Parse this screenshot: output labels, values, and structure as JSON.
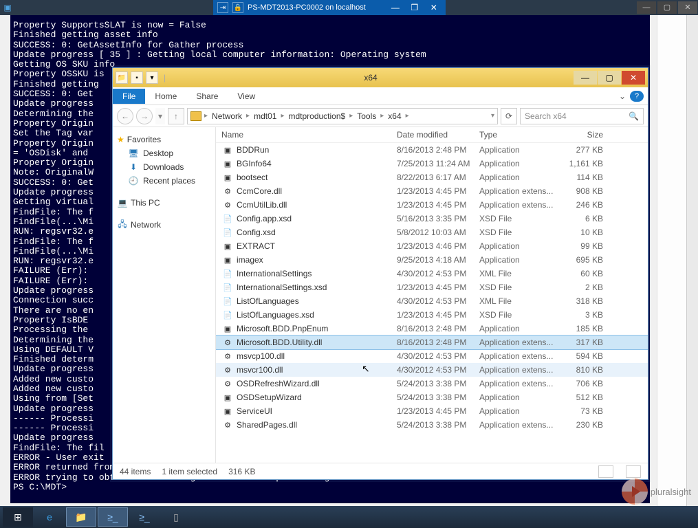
{
  "outer_window": {
    "title": ""
  },
  "vm_bar": {
    "title": "PS-MDT2013-PC0002 on localhost"
  },
  "console_lines": [
    "Property SupportsSLAT is now = False",
    "Finished getting asset info",
    "SUCCESS: 0: GetAssetInfo for Gather process",
    "Update progress [ 35 ] : Getting local computer information: Operating system",
    "Getting OS SKU info",
    "Property OSSKU is",
    "Finished getting",
    "SUCCESS: 0: Get",
    "Update progress",
    "Determining the",
    "Property Origin",
    "Set the Tag var",
    "Property Origin",
    "= 'OSDisk' and",
    "Property Origin",
    "Note: OriginalW",
    "SUCCESS: 0: Get",
    "Update progress",
    "Getting virtual",
    "FindFile: The f",
    "FindFile(...\\Mi",
    "RUN: regsvr32.e",
    "FindFile: The f",
    "FindFile(...\\Mi",
    "RUN: regsvr32.e",
    "FAILURE (Err):",
    "FAILURE (Err):",
    "Update progress",
    "Connection succ",
    "There are no en",
    "Property IsBDE",
    "Processing the",
    "Determining the",
    "Using DEFAULT V",
    "Finished determ",
    "Update progress",
    "Added new custo",
    "Added new custo",
    "Using from [Set",
    "Update progress",
    "------ Processi",
    "------ Processi",
    "Update progress",
    "FindFile: The fil",
    "ERROR - User exit",
    "ERROR returned from",
    "ERROR trying to obtain ini settings.  No further processing.",
    "PS C:\\MDT>"
  ],
  "explorer": {
    "title": "x64",
    "tabs": {
      "file": "File",
      "home": "Home",
      "share": "Share",
      "view": "View"
    },
    "breadcrumb": [
      "Network",
      "mdt01",
      "mdtproduction$",
      "Tools",
      "x64"
    ],
    "search_placeholder": "Search x64",
    "columns": {
      "name": "Name",
      "date": "Date modified",
      "type": "Type",
      "size": "Size"
    },
    "nav": {
      "favorites": "Favorites",
      "desktop": "Desktop",
      "downloads": "Downloads",
      "recent": "Recent places",
      "thispc": "This PC",
      "network": "Network"
    },
    "files": [
      {
        "name": "BDDRun",
        "date": "8/16/2013 2:48 PM",
        "type": "Application",
        "size": "277 KB"
      },
      {
        "name": "BGInfo64",
        "date": "7/25/2013 11:24 AM",
        "type": "Application",
        "size": "1,161 KB"
      },
      {
        "name": "bootsect",
        "date": "8/22/2013 6:17 AM",
        "type": "Application",
        "size": "114 KB"
      },
      {
        "name": "CcmCore.dll",
        "date": "1/23/2013 4:45 PM",
        "type": "Application extens...",
        "size": "908 KB"
      },
      {
        "name": "CcmUtilLib.dll",
        "date": "1/23/2013 4:45 PM",
        "type": "Application extens...",
        "size": "246 KB"
      },
      {
        "name": "Config.app.xsd",
        "date": "5/16/2013 3:35 PM",
        "type": "XSD File",
        "size": "6 KB"
      },
      {
        "name": "Config.xsd",
        "date": "5/8/2012 10:03 AM",
        "type": "XSD File",
        "size": "10 KB"
      },
      {
        "name": "EXTRACT",
        "date": "1/23/2013 4:46 PM",
        "type": "Application",
        "size": "99 KB"
      },
      {
        "name": "imagex",
        "date": "9/25/2013 4:18 AM",
        "type": "Application",
        "size": "695 KB"
      },
      {
        "name": "InternationalSettings",
        "date": "4/30/2012 4:53 PM",
        "type": "XML File",
        "size": "60 KB"
      },
      {
        "name": "InternationalSettings.xsd",
        "date": "1/23/2013 4:45 PM",
        "type": "XSD File",
        "size": "2 KB"
      },
      {
        "name": "ListOfLanguages",
        "date": "4/30/2012 4:53 PM",
        "type": "XML File",
        "size": "318 KB"
      },
      {
        "name": "ListOfLanguages.xsd",
        "date": "1/23/2013 4:45 PM",
        "type": "XSD File",
        "size": "3 KB"
      },
      {
        "name": "Microsoft.BDD.PnpEnum",
        "date": "8/16/2013 2:48 PM",
        "type": "Application",
        "size": "185 KB"
      },
      {
        "name": "Microsoft.BDD.Utility.dll",
        "date": "8/16/2013 2:48 PM",
        "type": "Application extens...",
        "size": "317 KB",
        "selected": true
      },
      {
        "name": "msvcp100.dll",
        "date": "4/30/2012 4:53 PM",
        "type": "Application extens...",
        "size": "594 KB"
      },
      {
        "name": "msvcr100.dll",
        "date": "4/30/2012 4:53 PM",
        "type": "Application extens...",
        "size": "810 KB",
        "hover": true
      },
      {
        "name": "OSDRefreshWizard.dll",
        "date": "5/24/2013 3:38 PM",
        "type": "Application extens...",
        "size": "706 KB"
      },
      {
        "name": "OSDSetupWizard",
        "date": "5/24/2013 3:38 PM",
        "type": "Application",
        "size": "512 KB"
      },
      {
        "name": "ServiceUI",
        "date": "1/23/2013 4:45 PM",
        "type": "Application",
        "size": "73 KB"
      },
      {
        "name": "SharedPages.dll",
        "date": "5/24/2013 3:38 PM",
        "type": "Application extens...",
        "size": "230 KB"
      }
    ],
    "status": {
      "count": "44 items",
      "selection": "1 item selected",
      "size": "316 KB"
    }
  },
  "brand": "pluralsight"
}
